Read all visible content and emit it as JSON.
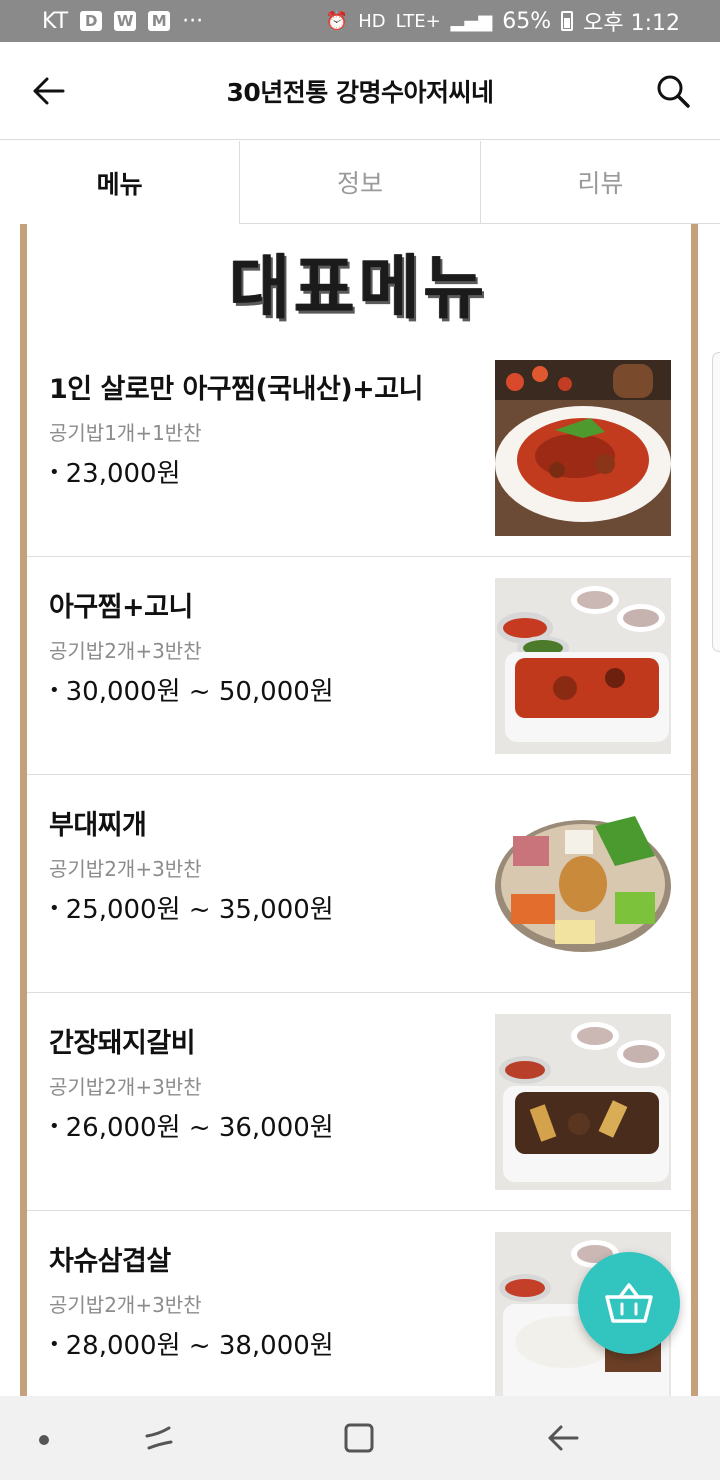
{
  "status_bar": {
    "carrier": "KT",
    "app_icons": [
      "D",
      "W",
      "M"
    ],
    "more": "···",
    "network": "LTE+",
    "battery": "65%",
    "time": "오후 1:12"
  },
  "header": {
    "title": "30년전통 강명수아저씨네"
  },
  "tabs": [
    {
      "label": "메뉴",
      "active": true
    },
    {
      "label": "정보",
      "active": false
    },
    {
      "label": "리뷰",
      "active": false
    }
  ],
  "hero": {
    "title": "대표메뉴"
  },
  "menu_items": [
    {
      "name": "1인 살로만 아구찜(국내산)+고니",
      "desc": "공기밥1개+1반찬",
      "price": "23,000원",
      "image": "spicy-monkfish-plate"
    },
    {
      "name": "아구찜+고니",
      "desc": "공기밥2개+3반찬",
      "price": "30,000원 ~ 50,000원",
      "image": "monkfish-takeout-box"
    },
    {
      "name": "부대찌개",
      "desc": "공기밥2개+3반찬",
      "price": "25,000원 ~ 35,000원",
      "image": "budae-jjigae-pot"
    },
    {
      "name": "간장돼지갈비",
      "desc": "공기밥2개+3반찬",
      "price": "26,000원 ~ 36,000원",
      "image": "soy-pork-ribs-box"
    },
    {
      "name": "차슈삼겹살",
      "desc": "공기밥2개+3반찬",
      "price": "28,000원 ~ 38,000원",
      "image": "chashu-pork-belly-box"
    }
  ],
  "colors": {
    "accent": "#32c5c0",
    "frame": "#c4a07c",
    "status_bar": "#8a8a8a"
  }
}
